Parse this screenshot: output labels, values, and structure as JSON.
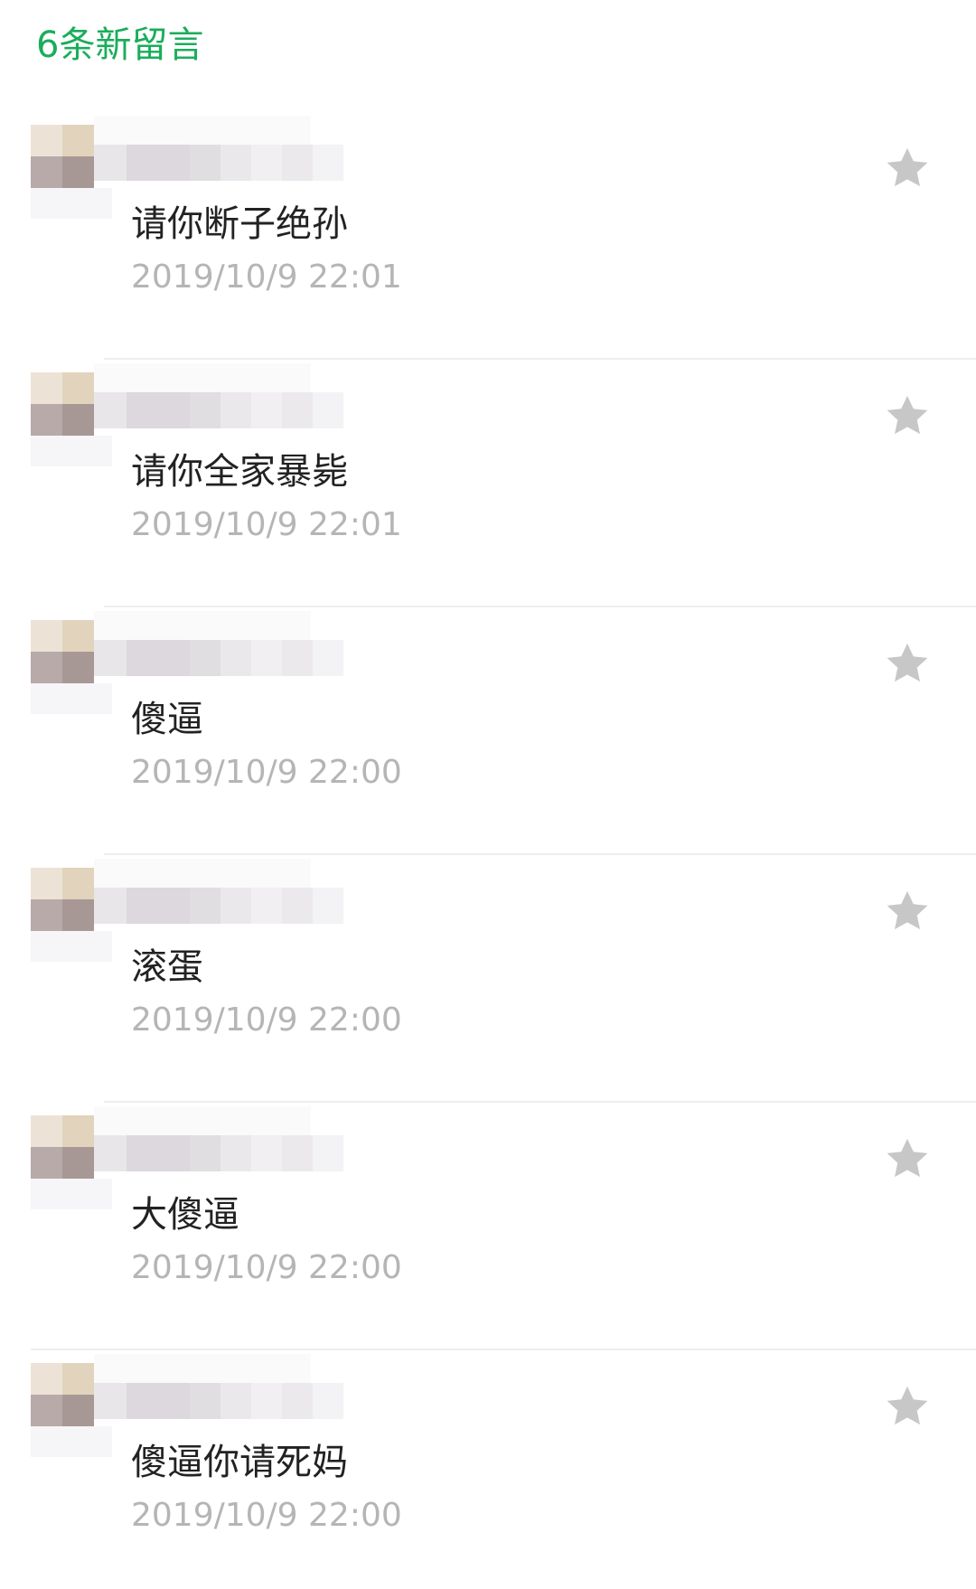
{
  "header": {
    "title": "6条新留言"
  },
  "messages": [
    {
      "text": "请你断子绝孙",
      "time": "2019/10/9 22:01"
    },
    {
      "text": "请你全家暴毙",
      "time": "2019/10/9 22:01"
    },
    {
      "text": "傻逼",
      "time": "2019/10/9 22:00"
    },
    {
      "text": "滚蛋",
      "time": "2019/10/9 22:00"
    },
    {
      "text": "大傻逼",
      "time": "2019/10/9 22:00"
    },
    {
      "text": "傻逼你请死妈",
      "time": "2019/10/9 22:00"
    }
  ],
  "colors": {
    "accent": "#1aad5b",
    "time_text": "#b5b5b5",
    "star_icon": "#c7c7c7"
  },
  "icons": {
    "favorite": "star-icon"
  }
}
